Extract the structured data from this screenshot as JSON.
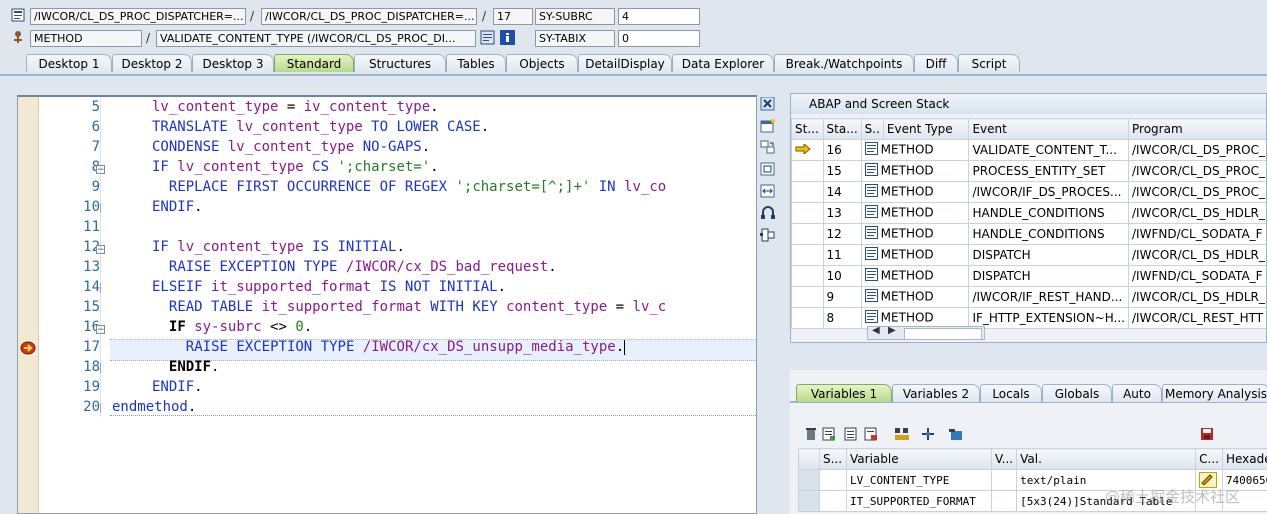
{
  "header": {
    "row1": {
      "field1": "/IWCOR/CL_DS_PROC_DISPATCHER=...",
      "sep1": "/",
      "field2": "/IWCOR/CL_DS_PROC_DISPATCHER=...",
      "sep2": "/",
      "field3": "17",
      "sysfield": "SY-SUBRC",
      "sysvalue": "4"
    },
    "row2": {
      "field1": "METHOD",
      "sep1": "/",
      "field2": "VALIDATE_CONTENT_TYPE (/IWCOR/CL_DS_PROC_DI...",
      "sysfield": "SY-TABIX",
      "sysvalue": "0"
    }
  },
  "tabs": [
    "Desktop 1",
    "Desktop 2",
    "Desktop 3",
    "Standard",
    "Structures",
    "Tables",
    "Objects",
    "DetailDisplay",
    "Data Explorer",
    "Break./Watchpoints",
    "Diff",
    "Script"
  ],
  "active_tab": "Standard",
  "editor": {
    "lines": [
      {
        "no": "5",
        "segs": [
          [
            "id",
            "lv_content_type"
          ],
          [
            "plain",
            " = "
          ],
          [
            "id",
            "iv_content_type"
          ],
          [
            "plain",
            "."
          ]
        ],
        "indent": 2
      },
      {
        "no": "6",
        "segs": [
          [
            "kw",
            "TRANSLATE "
          ],
          [
            "id",
            "lv_content_type"
          ],
          [
            "kw",
            " TO LOWER CASE"
          ],
          [
            "plain",
            "."
          ]
        ],
        "indent": 2
      },
      {
        "no": "7",
        "segs": [
          [
            "kw",
            "CONDENSE "
          ],
          [
            "id",
            "lv_content_type"
          ],
          [
            "kw",
            " NO-GAPS"
          ],
          [
            "plain",
            "."
          ]
        ],
        "indent": 2
      },
      {
        "no": "8",
        "segs": [
          [
            "kw",
            "IF "
          ],
          [
            "id",
            "lv_content_type"
          ],
          [
            "kw",
            " CS "
          ],
          [
            "st",
            "';charset='"
          ],
          [
            "plain",
            "."
          ]
        ],
        "indent": 2
      },
      {
        "no": "9",
        "segs": [
          [
            "kw",
            "REPLACE FIRST OCCURRENCE OF REGEX "
          ],
          [
            "st",
            "';charset=[^;]+'"
          ],
          [
            "kw",
            " IN "
          ],
          [
            "id",
            "lv_co"
          ]
        ],
        "indent": 3
      },
      {
        "no": "10",
        "segs": [
          [
            "kw",
            "ENDIF"
          ],
          [
            "plain",
            "."
          ]
        ],
        "indent": 2
      },
      {
        "no": "11",
        "segs": [],
        "indent": 2
      },
      {
        "no": "12",
        "segs": [
          [
            "kw",
            "IF "
          ],
          [
            "id",
            "lv_content_type"
          ],
          [
            "kw",
            " IS INITIAL"
          ],
          [
            "plain",
            "."
          ]
        ],
        "indent": 2
      },
      {
        "no": "13",
        "segs": [
          [
            "kw",
            "RAISE EXCEPTION TYPE "
          ],
          [
            "id",
            "/IWCOR/cx_DS_bad_request"
          ],
          [
            "plain",
            "."
          ]
        ],
        "indent": 3
      },
      {
        "no": "14",
        "segs": [
          [
            "kw",
            "ELSEIF "
          ],
          [
            "id",
            "it_supported_format"
          ],
          [
            "kw",
            " IS NOT INITIAL"
          ],
          [
            "plain",
            "."
          ]
        ],
        "indent": 2
      },
      {
        "no": "15",
        "segs": [
          [
            "kw",
            "READ TABLE "
          ],
          [
            "id",
            "it_supported_format"
          ],
          [
            "kw",
            " WITH KEY "
          ],
          [
            "id",
            "content_type"
          ],
          [
            "plain",
            " = "
          ],
          [
            "id",
            "lv_c"
          ]
        ],
        "indent": 3
      },
      {
        "no": "16",
        "segs": [
          [
            "kwb",
            "IF "
          ],
          [
            "id",
            "sy-subrc"
          ],
          [
            "plain",
            " <> "
          ],
          [
            "num",
            "0"
          ],
          [
            "plain",
            "."
          ]
        ],
        "indent": 3
      },
      {
        "no": "17",
        "segs": [
          [
            "kw",
            "RAISE EXCEPTION TYPE "
          ],
          [
            "id",
            "/IWCOR/cx_DS_unsupp_media_type"
          ],
          [
            "plain",
            "."
          ]
        ],
        "indent": 4
      },
      {
        "no": "18",
        "segs": [
          [
            "kwb",
            "ENDIF"
          ],
          [
            "plain",
            "."
          ]
        ],
        "indent": 3
      },
      {
        "no": "19",
        "segs": [
          [
            "kw",
            "ENDIF"
          ],
          [
            "plain",
            "."
          ]
        ],
        "indent": 2
      },
      {
        "no": "20",
        "segs": [
          [
            "kw",
            "endmethod"
          ],
          [
            "plain",
            "."
          ]
        ],
        "indent": 0
      }
    ],
    "current_line": "17"
  },
  "stack": {
    "title": "ABAP and Screen Stack",
    "columns": [
      "St...",
      "Sta...",
      "S..",
      "Event Type",
      "Event",
      "Program"
    ],
    "rows": [
      {
        "level": "16",
        "type": "METHOD",
        "event": "VALIDATE_CONTENT_T...",
        "program": "/IWCOR/CL_DS_PROC_"
      },
      {
        "level": "15",
        "type": "METHOD",
        "event": "PROCESS_ENTITY_SET",
        "program": "/IWCOR/CL_DS_PROC_"
      },
      {
        "level": "14",
        "type": "METHOD",
        "event": "/IWCOR/IF_DS_PROCES...",
        "program": "/IWCOR/CL_DS_PROC_"
      },
      {
        "level": "13",
        "type": "METHOD",
        "event": "HANDLE_CONDITIONS",
        "program": "/IWCOR/CL_DS_HDLR_"
      },
      {
        "level": "12",
        "type": "METHOD",
        "event": "HANDLE_CONDITIONS",
        "program": "/IWFND/CL_SODATA_F"
      },
      {
        "level": "11",
        "type": "METHOD",
        "event": "DISPATCH",
        "program": "/IWCOR/CL_DS_HDLR_"
      },
      {
        "level": "10",
        "type": "METHOD",
        "event": "DISPATCH",
        "program": "/IWFND/CL_SODATA_F"
      },
      {
        "level": "9",
        "type": "METHOD",
        "event": "/IWCOR/IF_REST_HAND...",
        "program": "/IWCOR/CL_DS_HDLR_"
      },
      {
        "level": "8",
        "type": "METHOD",
        "event": "IF_HTTP_EXTENSION~H...",
        "program": "/IWCOR/CL_REST_HTT"
      }
    ]
  },
  "vars": {
    "tabs": [
      "Variables 1",
      "Variables 2",
      "Locals",
      "Globals",
      "Auto",
      "Memory Analysis"
    ],
    "active_tab": "Variables 1",
    "columns": [
      "S...",
      "Variable",
      "V...",
      "Val.",
      "C...",
      "Hexade"
    ],
    "rows": [
      {
        "variable": "LV_CONTENT_TYPE",
        "value": "text/plain",
        "hex": "7400650"
      },
      {
        "variable": "IT_SUPPORTED_FORMAT",
        "value": "[5x3(24)]Standard Table",
        "hex": ""
      }
    ]
  },
  "watermark": "@稀土掘金技术社区"
}
